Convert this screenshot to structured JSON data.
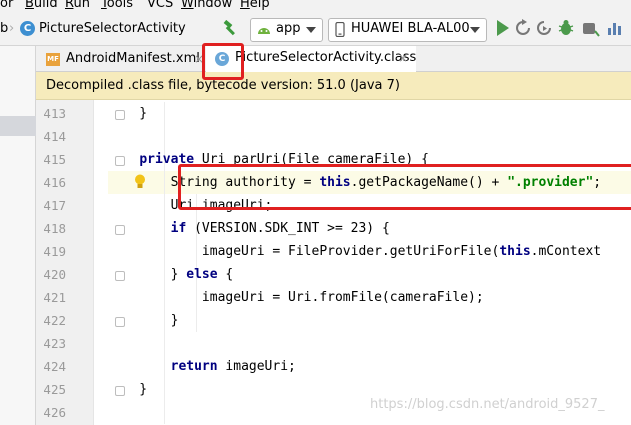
{
  "menubar": {
    "items": [
      "or",
      "Build",
      "Run",
      "Tools",
      "VCS",
      "Window",
      "Help"
    ],
    "mnemonics": [
      "",
      "B",
      "R",
      "T",
      "S",
      "W",
      "H"
    ]
  },
  "toolbar": {
    "breadcrumb_prefix": "b",
    "breadcrumb_label": "PictureSelectorActivity",
    "config_label": "app",
    "device_label": "HUAWEI BLA-AL00"
  },
  "tabs": [
    {
      "label": "AndroidManifest.xml",
      "icon": "manifest-file-icon",
      "close": "×"
    },
    {
      "label": "PictureSelectorActivity.class",
      "icon": "class-file-icon",
      "close": "×"
    }
  ],
  "banner": {
    "text": "Decompiled .class file, bytecode version: 51.0 (Java 7)"
  },
  "editor": {
    "line_numbers": [
      "413",
      "414",
      "415",
      "416",
      "417",
      "418",
      "419",
      "420",
      "421",
      "422",
      "423",
      "424",
      "425",
      "426"
    ],
    "highlighted_line": "416",
    "lines": [
      [
        {
          "t": "    }",
          "c": ""
        }
      ],
      [
        {
          "t": "",
          "c": ""
        }
      ],
      [
        {
          "t": "    ",
          "c": ""
        },
        {
          "t": "private",
          "c": "kw"
        },
        {
          "t": " Uri parUri(File cameraFile) {",
          "c": ""
        }
      ],
      [
        {
          "t": "        String authority = ",
          "c": ""
        },
        {
          "t": "this",
          "c": "kw"
        },
        {
          "t": ".getPackageName() + ",
          "c": ""
        },
        {
          "t": "\".provider\"",
          "c": "str"
        },
        {
          "t": ";",
          "c": ""
        }
      ],
      [
        {
          "t": "        Uri imageUri;",
          "c": ""
        }
      ],
      [
        {
          "t": "        ",
          "c": ""
        },
        {
          "t": "if",
          "c": "kw"
        },
        {
          "t": " (VERSION.SDK_INT >= 23) {",
          "c": ""
        }
      ],
      [
        {
          "t": "            imageUri = FileProvider.getUriForFile(",
          "c": ""
        },
        {
          "t": "this",
          "c": "kw"
        },
        {
          "t": ".mContext",
          "c": ""
        }
      ],
      [
        {
          "t": "        } ",
          "c": ""
        },
        {
          "t": "else",
          "c": "kw"
        },
        {
          "t": " {",
          "c": ""
        }
      ],
      [
        {
          "t": "            imageUri = Uri.fromFile(cameraFile);",
          "c": ""
        }
      ],
      [
        {
          "t": "        }",
          "c": ""
        }
      ],
      [
        {
          "t": "",
          "c": ""
        }
      ],
      [
        {
          "t": "        ",
          "c": ""
        },
        {
          "t": "return",
          "c": "kw"
        },
        {
          "t": " imageUri;",
          "c": ""
        }
      ],
      [
        {
          "t": "    }",
          "c": ""
        }
      ],
      [
        {
          "t": "",
          "c": ""
        }
      ]
    ]
  },
  "watermark": "https://blog.csdn.net/android_9527_",
  "colors": {
    "keyword": "#000080",
    "string": "#008000",
    "annotation_box": "#e02020",
    "banner_bg": "#f6ebbc",
    "active_tab_underline": "#4083c9"
  }
}
